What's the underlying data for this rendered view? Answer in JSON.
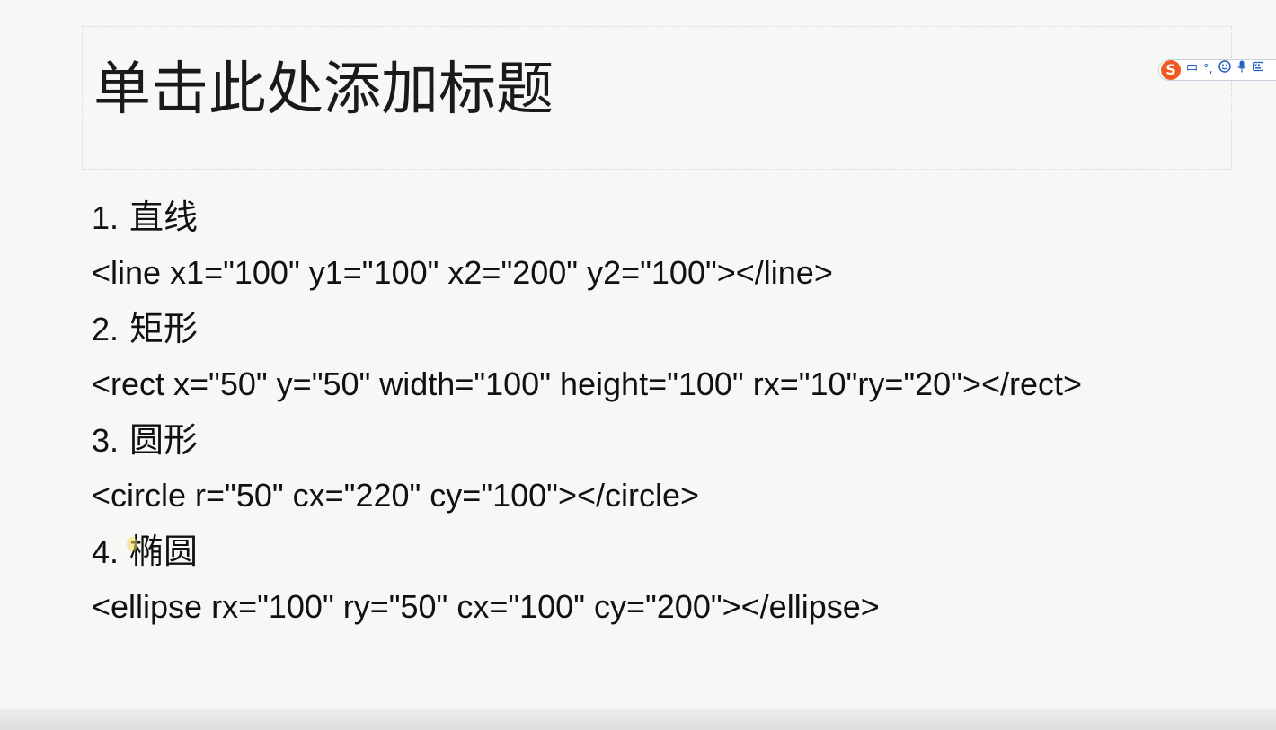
{
  "slide": {
    "title": "单击此处添加标题",
    "items": [
      {
        "num": "1.",
        "heading": "直线",
        "code": "<line x1=\"100\" y1=\"100\" x2=\"200\" y2=\"100\"></line>"
      },
      {
        "num": "2.",
        "heading": "矩形",
        "code": "<rect x=\"50\" y=\"50\" width=\"100\" height=\"100\" rx=\"10\"ry=\"20\"></rect>"
      },
      {
        "num": "3.",
        "heading": "圆形",
        "code": "<circle r=\"50\" cx=\"220\" cy=\"100\"></circle>"
      },
      {
        "num": "4.",
        "heading": "椭圆",
        "code": "<ellipse rx=\"100\" ry=\"50\" cx=\"100\" cy=\"200\"></ellipse>"
      }
    ]
  },
  "ime_toolbar": {
    "logo": "S",
    "mode": "中",
    "punct": "°,",
    "icons": [
      "emoji-icon",
      "microphone-icon",
      "keyboard-icon"
    ],
    "logo_color": "#f05a22",
    "icon_color": "#1f5fbf"
  }
}
